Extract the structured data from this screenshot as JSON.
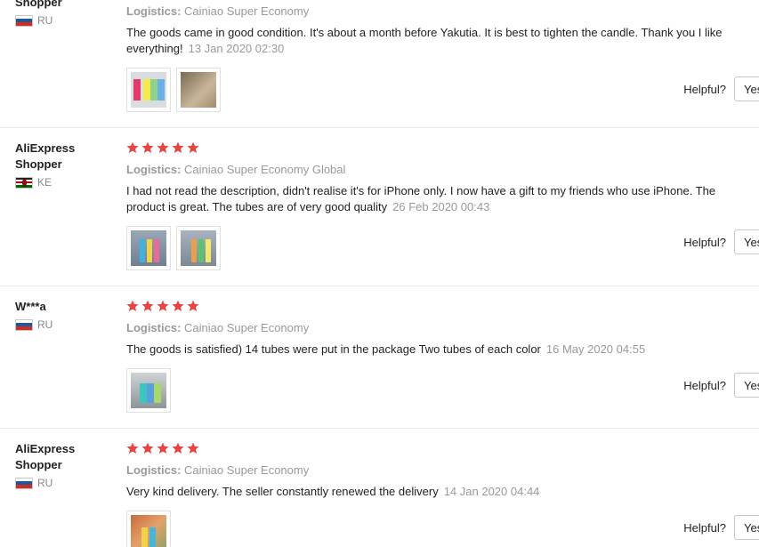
{
  "helpful_label": "Helpful?",
  "yes_label": "Yes",
  "star_color": "#e64545",
  "reviews": [
    {
      "user": "Shopper",
      "country": "RU",
      "stars": 0,
      "logistics_label": "Logistics:",
      "logistics": "Cainiao Super Economy",
      "text": "The goods came in good condition. It's about a month before Yakutia. It is best to tighten the candle. Thank you I like everything!",
      "date": "13 Jan 2020 02:30",
      "photos": 2
    },
    {
      "user": "AliExpress Shopper",
      "country": "KE",
      "stars": 5,
      "logistics_label": "Logistics:",
      "logistics": "Cainiao Super Economy Global",
      "text": "I had not read the description, didn't realise it's for iPhone only. I now have a gift to my friends who use iPhone. The product is great. The tubes are of very good quality",
      "date": "26 Feb 2020 00:43",
      "photos": 2
    },
    {
      "user": "W***a",
      "country": "RU",
      "stars": 5,
      "logistics_label": "Logistics:",
      "logistics": "Cainiao Super Economy",
      "text": "The goods is satisfied) 14 tubes were put in the package Two tubes of each color",
      "date": "16 May 2020 04:55",
      "photos": 1
    },
    {
      "user": "AliExpress Shopper",
      "country": "RU",
      "stars": 5,
      "logistics_label": "Logistics:",
      "logistics": "Cainiao Super Economy",
      "text": "Very kind delivery. The seller constantly renewed the delivery",
      "date": "14 Jan 2020 04:44",
      "photos": 1
    }
  ]
}
